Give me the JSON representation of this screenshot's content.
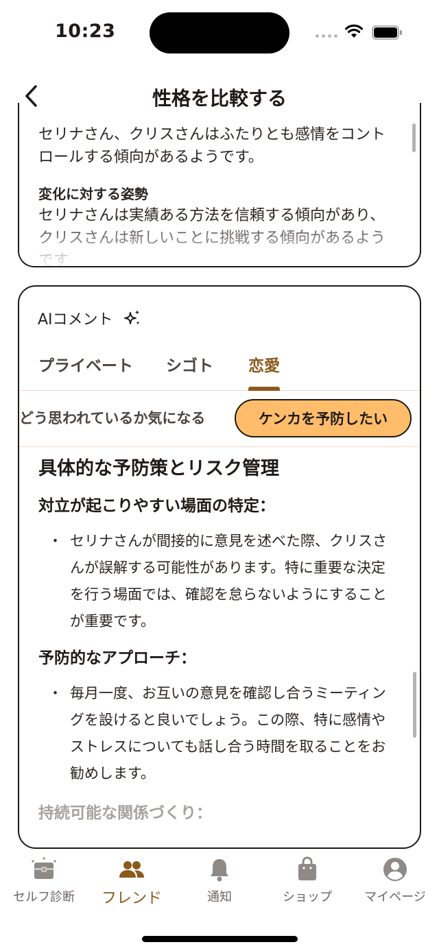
{
  "status": {
    "time": "10:23"
  },
  "header": {
    "title": "性格を比較する"
  },
  "summary": {
    "text1": "セリナさん、クリスさんはふたりとも感情をコントロールする傾向があるようです。",
    "section_title": "変化に対する姿勢",
    "text2": "セリナさんは実績ある方法を信頼する傾向があり、クリスさんは新しいことに挑戦する傾向があるようです"
  },
  "ai": {
    "title": "AIコメント",
    "tabs": [
      "プライベート",
      "シゴト",
      "恋愛"
    ],
    "active_tab": "恋愛",
    "chips": [
      "どう思われているか気になる",
      "ケンカを予防したい"
    ],
    "active_chip": "ケンカを予防したい",
    "heading": "具体的な予防策とリスク管理",
    "sections": [
      {
        "title": "対立が起こりやすい場面の特定：",
        "bullet": "セリナさんが間接的に意見を述べた際、クリスさんが誤解する可能性があります。特に重要な決定を行う場面では、確認を怠らないようにすることが重要です。"
      },
      {
        "title": "予防的なアプローチ：",
        "bullet": "毎月一度、お互いの意見を確認し合うミーティングを設けると良いでしょう。この際、特に感情やストレスについても話し合う時間を取ることをお勧めします。"
      },
      {
        "title": "持続可能な関係づくり："
      }
    ],
    "bullet_mark": "・"
  },
  "tabbar": {
    "items": [
      {
        "label": "セルフ診断",
        "icon": "treasure-chest-icon"
      },
      {
        "label": "フレンド",
        "icon": "friends-icon"
      },
      {
        "label": "通知",
        "icon": "bell-icon"
      },
      {
        "label": "ショップ",
        "icon": "shopping-bag-icon"
      },
      {
        "label": "マイページ",
        "icon": "user-circle-icon"
      }
    ],
    "active": "フレンド"
  },
  "colors": {
    "accent": "#8a5a1c",
    "chip_active": "#ffbd6b",
    "divider": "#f0d8c8",
    "border": "#1f1a17"
  }
}
